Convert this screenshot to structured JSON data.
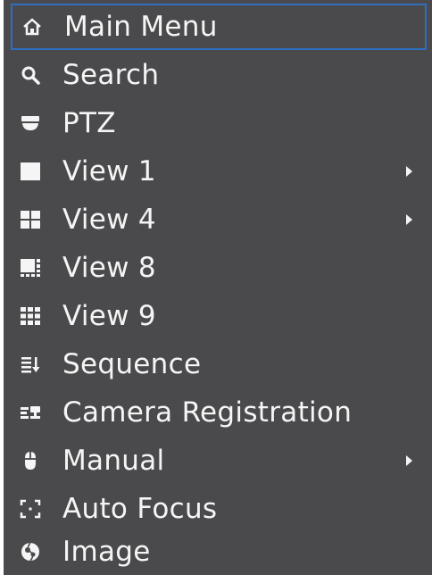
{
  "menu": {
    "items": [
      {
        "label": "Main Menu",
        "icon": "home-icon"
      },
      {
        "label": "Search",
        "icon": "search-icon"
      },
      {
        "label": "PTZ",
        "icon": "ptz-camera-icon"
      },
      {
        "label": "View 1",
        "icon": "view-1-icon",
        "has_submenu": true
      },
      {
        "label": "View 4",
        "icon": "view-4-icon",
        "has_submenu": true
      },
      {
        "label": "View 8",
        "icon": "view-8-icon"
      },
      {
        "label": "View 9",
        "icon": "view-9-icon"
      },
      {
        "label": "Sequence",
        "icon": "sequence-icon"
      },
      {
        "label": "Camera Registration",
        "icon": "camera-registration-icon"
      },
      {
        "label": "Manual",
        "icon": "manual-mouse-icon",
        "has_submenu": true
      },
      {
        "label": "Auto Focus",
        "icon": "auto-focus-icon"
      },
      {
        "label": "Image",
        "icon": "image-icon"
      }
    ],
    "selected_index": 0
  },
  "colors": {
    "background": "#4a4a4c",
    "text": "#f5f5f5",
    "selection_border": "#2f6fbe"
  }
}
